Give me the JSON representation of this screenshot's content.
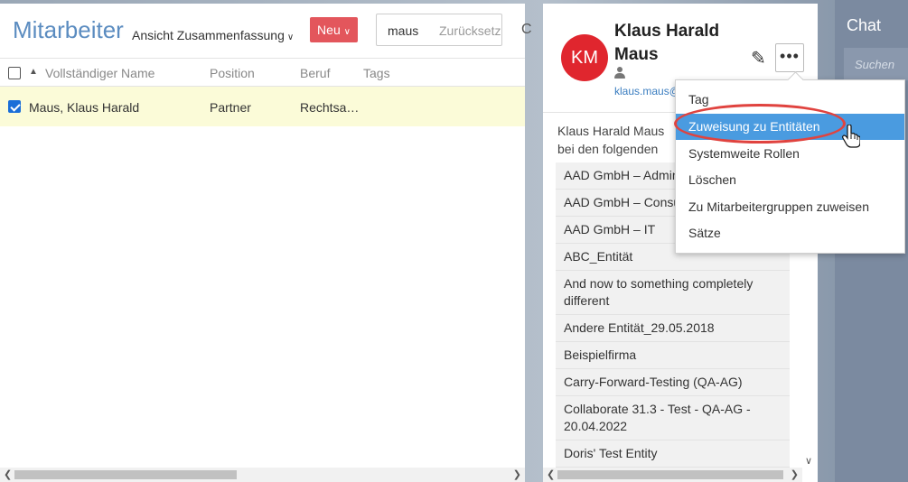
{
  "left_panel": {
    "title": "Mitarbeiter",
    "view_label": "Ansicht Zusammenfassung",
    "new_button": "Neu",
    "search_value": "maus",
    "reset_label": "Zurücksetzen",
    "trailing_glyph": "C",
    "columns": [
      "Vollständiger Name",
      "Position",
      "Beruf",
      "Tags"
    ],
    "rows": [
      {
        "name": "Maus, Klaus Harald",
        "position": "Partner",
        "beruf": "Rechtsa…",
        "tags": "",
        "checked": true
      }
    ]
  },
  "detail": {
    "initials": "KM",
    "avatar_color": "#e0262e",
    "name": "Klaus Harald Maus",
    "email": "klaus.maus@",
    "description": "Klaus Harald Maus bei den folgenden Entitäten.",
    "entities": [
      "AAD GmbH – Administration",
      "AAD GmbH – Consulting",
      "AAD GmbH – IT",
      "ABC_Entität",
      "And now to something completely different",
      "Andere Entität_29.05.2018",
      "Beispielfirma",
      "Carry-Forward-Testing (QA-AG)",
      "Collaborate 31.3 - Test - QA-AG - 20.04.2022",
      "Doris' Test Entity"
    ]
  },
  "menu": {
    "items": [
      "Tag",
      "Zuweisung zu Entitäten",
      "Systemweite Rollen",
      "Löschen",
      "Zu Mitarbeitergruppen zuweisen",
      "Sätze"
    ],
    "active_index": 1,
    "active_color": "#4a9be0",
    "highlight_color": "#e0433f"
  },
  "chat": {
    "title": "Chat",
    "search_placeholder": "Suchen"
  },
  "icons": {
    "sort": "sort-ascending-icon",
    "edit": "pencil-icon",
    "more": "more-horizontal-icon",
    "person": "person-icon",
    "cursor": "hand-pointer-icon"
  },
  "accent_colors": {
    "title_blue": "#5b8cc0",
    "new_button_red": "#e3565c",
    "selected_row": "#fbfbd8"
  }
}
